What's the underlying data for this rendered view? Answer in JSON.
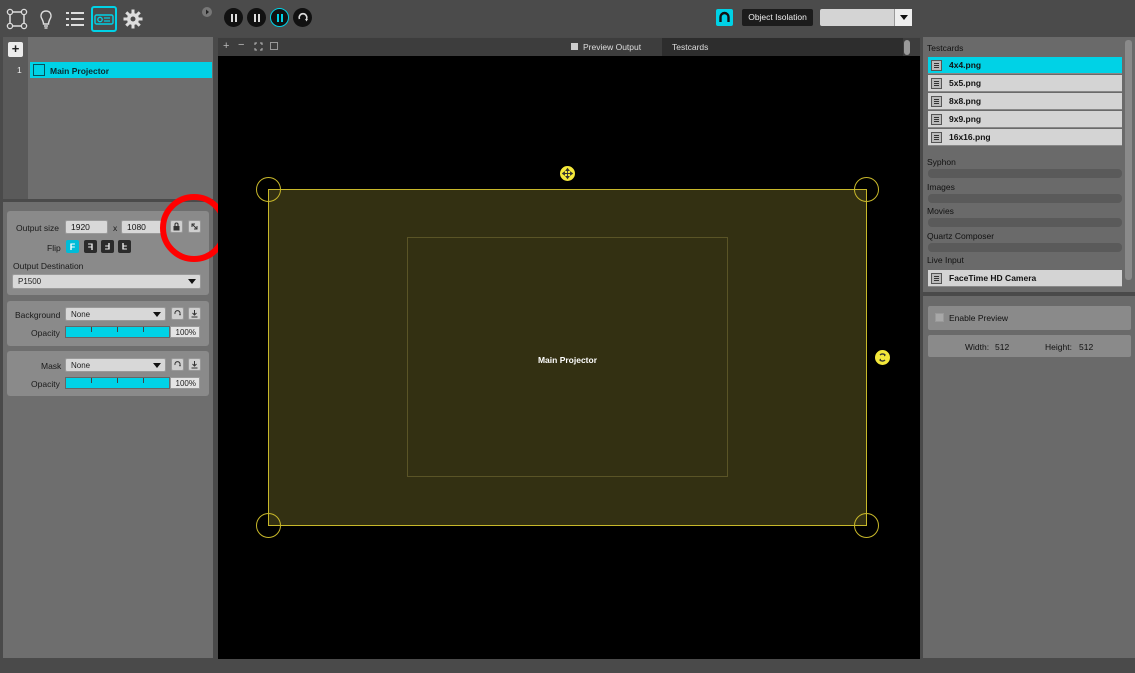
{
  "toolbar": {
    "icons": [
      "surfaces-icon",
      "bulb-icon",
      "list-icon",
      "projector-icon",
      "gear-icon"
    ],
    "object_isolation_label": "Object Isolation",
    "isolation_select_value": ""
  },
  "projectors": {
    "add_label": "+",
    "items": [
      {
        "index": "1",
        "name": "Main Projector"
      }
    ]
  },
  "output": {
    "size_label": "Output size",
    "width": "1920",
    "x_label": "x",
    "height": "1080",
    "flip_label": "Flip",
    "flip_buttons": [
      "F",
      "F",
      "F",
      "F"
    ],
    "destination_label": "Output Destination",
    "destination_value": "P1500"
  },
  "background": {
    "label": "Background",
    "value": "None",
    "opacity_label": "Opacity",
    "opacity_value": "100%",
    "opacity": 1.0
  },
  "mask": {
    "label": "Mask",
    "value": "None",
    "opacity_label": "Opacity",
    "opacity_value": "100%",
    "opacity": 1.0
  },
  "stage": {
    "preview_output_label": "Preview Output",
    "tab_label": "Testcards",
    "projector_label": "Main Projector"
  },
  "sources": {
    "testcards_label": "Testcards",
    "testcards": [
      "4x4.png",
      "5x5.png",
      "8x8.png",
      "9x9.png",
      "16x16.png"
    ],
    "syphon_label": "Syphon",
    "images_label": "Images",
    "movies_label": "Movies",
    "quartz_label": "Quartz Composer",
    "live_input_label": "Live Input",
    "live_inputs": [
      "FaceTime HD Camera"
    ]
  },
  "preview": {
    "enable_label": "Enable Preview",
    "width_label": "Width:",
    "width_value": "512",
    "height_label": "Height:",
    "height_value": "512"
  },
  "colors": {
    "accent": "#00d2e6",
    "highlight_ring": "#ff0000",
    "surface_outline": "#c8b82a",
    "surface_fill": "#333012",
    "handle": "#f4e83a"
  }
}
